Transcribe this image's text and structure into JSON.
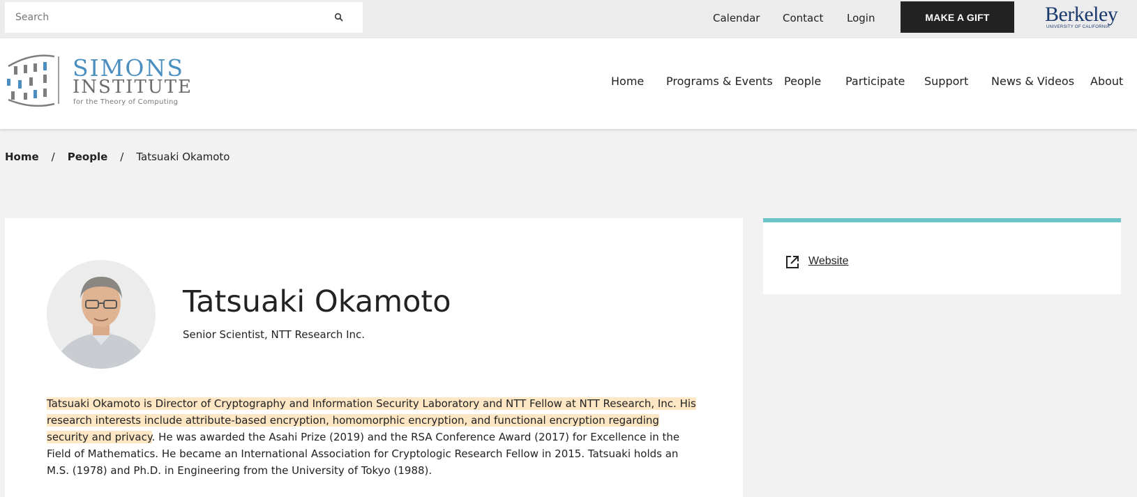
{
  "utility": {
    "search_placeholder": "Search",
    "links": [
      "Calendar",
      "Contact",
      "Login"
    ],
    "gift_label": "MAKE A GIFT",
    "berkeley_word": "Berkeley",
    "berkeley_sub": "UNIVERSITY OF CALIFORNIA"
  },
  "logo": {
    "line1": "SIMONS",
    "line2": "INSTITUTE",
    "tagline": "for the Theory of Computing"
  },
  "nav": [
    "Home",
    "Programs & Events",
    "People",
    "Participate",
    "Support",
    "News & Videos",
    "About"
  ],
  "breadcrumb": {
    "home": "Home",
    "separator": "/",
    "people": "People",
    "current": "Tatsuaki Okamoto"
  },
  "profile": {
    "name": "Tatsuaki Okamoto",
    "title": "Senior Scientist, NTT Research Inc.",
    "bio_highlight": "Tatsuaki Okamoto is Director of Cryptography and Information Security Laboratory and NTT Fellow at NTT Research, Inc. His research interests include attribute-based encryption, homomorphic encryption, and functional encryption regarding security and privacy",
    "bio_rest": ". He was awarded the Asahi Prize (2019) and the RSA Conference Award (2017) for Excellence in the Field of Mathematics. He became an International Association for Cryptologic Research Fellow in 2015. Tatsuaki holds an M.S. (1978) and Ph.D. in Engineering from the University of Tokyo (1988)."
  },
  "sidebar": {
    "website_label": "Website",
    "icon": "external-link-icon"
  },
  "colors": {
    "accent": "#6cc3c9",
    "highlight": "#fde6c3",
    "simons_blue": "#4a8fc0",
    "berkeley_blue": "#1a3a6e"
  }
}
